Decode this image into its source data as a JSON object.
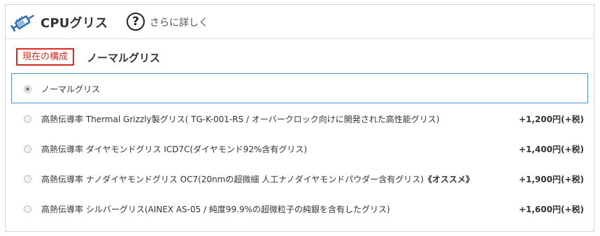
{
  "header": {
    "title": "CPUグリス",
    "help_label": "さらに詳しく"
  },
  "current": {
    "badge": "現在の構成",
    "value": "ノーマルグリス"
  },
  "options": [
    {
      "label": "ノーマルグリス",
      "emphasis": "",
      "price": "",
      "selected": true
    },
    {
      "label": "高熱伝導率 Thermal Grizzly製グリス( TG-K-001-RS / オーバークロック向けに開発された高性能グリス)",
      "emphasis": "",
      "price": "+1,200円(+税)",
      "selected": false
    },
    {
      "label": "高熱伝導率 ダイヤモンドグリス ICD7C(ダイヤモンド92%含有グリス)",
      "emphasis": "",
      "price": "+1,400円(+税)",
      "selected": false
    },
    {
      "label": "高熱伝導率 ナノダイヤモンドグリス OC7(20nmの超微細 人工ナノダイヤモンドパウダー含有グリス)",
      "emphasis": "《オススメ》",
      "price": "+1,900円(+税)",
      "selected": false
    },
    {
      "label": "高熱伝導率 シルバーグリス(AINEX AS-05 / 純度99.9%の超微粒子の純銀を含有したグリス)",
      "emphasis": "",
      "price": "+1,600円(+税)",
      "selected": false
    }
  ],
  "colors": {
    "badge_red": "#d9291d",
    "selected_border": "#4a95d0",
    "icon_blue": "#2f6fb0"
  }
}
